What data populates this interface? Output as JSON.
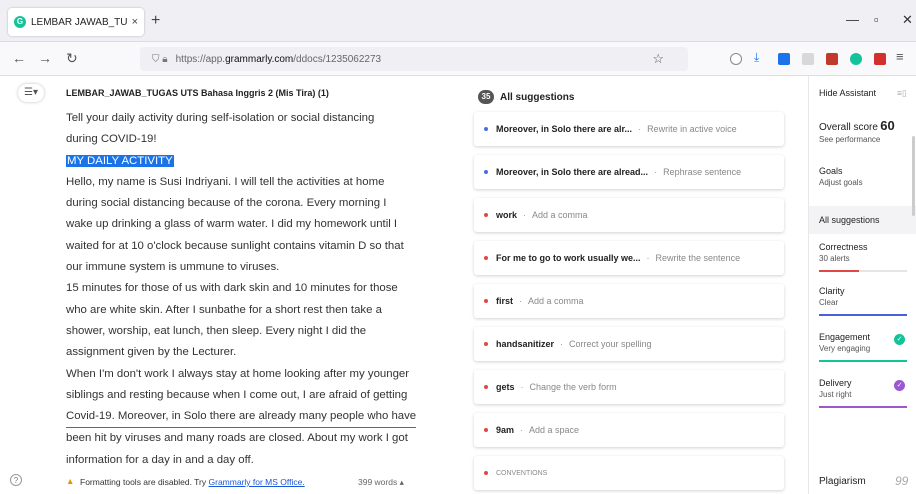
{
  "browser": {
    "tab_title": "LEMBAR JAWAB_TUGAS UTS Ba",
    "tab_close": "×",
    "new_tab": "+",
    "url_prefix": "https://app.",
    "url_domain": "grammarly.com",
    "url_path": "/ddocs/1235062273"
  },
  "document": {
    "title": "LEMBAR_JAWAB_TUGAS UTS Bahasa Inggris 2 (Mis Tira) (1)",
    "lines": [
      "Tell your daily activity during self-isolation or social distancing",
      "during COVID-19!",
      "MY DAILY ACTIVITY",
      "Hello, my name is Susi Indriyani. I will tell the activities at home",
      "during social distancing because of the corona. Every morning I",
      "wake up drinking a glass of warm water.  I did my homework until I",
      "waited for at 10 o'clock because sunlight contains vitamin D so that",
      "our immune system is ummune to viruses.",
      "15 minutes for those of us with dark skin and 10 minutes for those",
      "who are white skin. After I sunbathe for a short rest then take a",
      "shower, worship, eat lunch, then sleep. Every night I did the",
      "assignment given by the Lecturer.",
      "When I'm don't work I always stay at home looking after my younger",
      "siblings and resting because when I come out, I are afraid of getting",
      "Covid-19. Moreover, in Solo there are already many people who have",
      "been hit by viruses and many roads are closed. About my work I got",
      "information for a day in and a day off."
    ],
    "word_count": "399 words ▴"
  },
  "footer": {
    "help": "?",
    "notice_prefix": "Formatting tools are disabled. Try ",
    "notice_link": "Grammarly for MS Office."
  },
  "suggestions": {
    "count": "35",
    "header": "All suggestions",
    "items": [
      {
        "text": "Moreover, in Solo there are alr...",
        "action": "Rewrite in active voice",
        "color": "#4a6ee0"
      },
      {
        "text": "Moreover, in Solo there are alread...",
        "action": "Rephrase sentence",
        "color": "#4a6ee0"
      },
      {
        "text": "work",
        "action": "Add a comma",
        "color": "#e04848"
      },
      {
        "text": "For me to go to work usually we...",
        "action": "Rewrite the sentence",
        "color": "#e04848"
      },
      {
        "text": "first",
        "action": "Add a comma",
        "color": "#e04848"
      },
      {
        "text": "handsanitizer",
        "action": "Correct your spelling",
        "color": "#e04848"
      },
      {
        "text": "gets",
        "action": "Change the verb form",
        "color": "#e04848"
      },
      {
        "text": "9am",
        "action": "Add a space",
        "color": "#e04848"
      },
      {
        "text": "CONVENTIONS",
        "action": "",
        "color": "#e04848"
      }
    ]
  },
  "sidebar": {
    "hide_assistant": "Hide Assistant",
    "overall_label": "Overall score",
    "overall_score": "60",
    "see_performance": "See performance",
    "goals": "Goals",
    "adjust_goals": "Adjust goals",
    "all_suggestions": "All suggestions",
    "correctness": "Correctness",
    "correctness_sub": "30 alerts",
    "clarity": "Clarity",
    "clarity_sub": "Clear",
    "engagement": "Engagement",
    "engagement_sub": "Very engaging",
    "delivery": "Delivery",
    "delivery_sub": "Just right",
    "plagiarism": "Plagiarism",
    "plagiarism_icon": "99",
    "colors": {
      "correctness": "#e04848",
      "clarity": "#4b5fd7",
      "engagement": "#15c39a",
      "delivery": "#9b59d0"
    }
  }
}
